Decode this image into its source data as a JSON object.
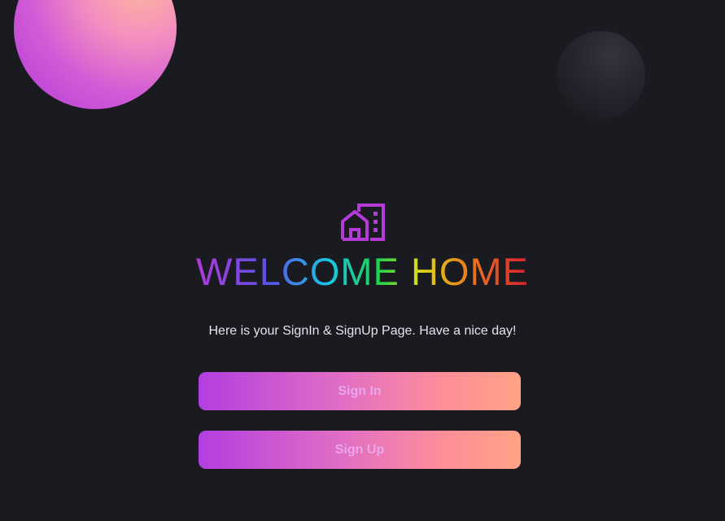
{
  "hero": {
    "logo_icon": "house-building-icon",
    "title": "WELCOME HOME",
    "subtitle": "Here is your SignIn & SignUp Page. Have a nice day!"
  },
  "actions": {
    "sign_in_label": "Sign In",
    "sign_up_label": "Sign Up"
  },
  "colors": {
    "background": "#1a1a21",
    "button_gradient_start": "#b33ee0",
    "button_gradient_end": "#ffa385",
    "button_text": "#e9a6ef",
    "logo": "#b43bd8"
  }
}
